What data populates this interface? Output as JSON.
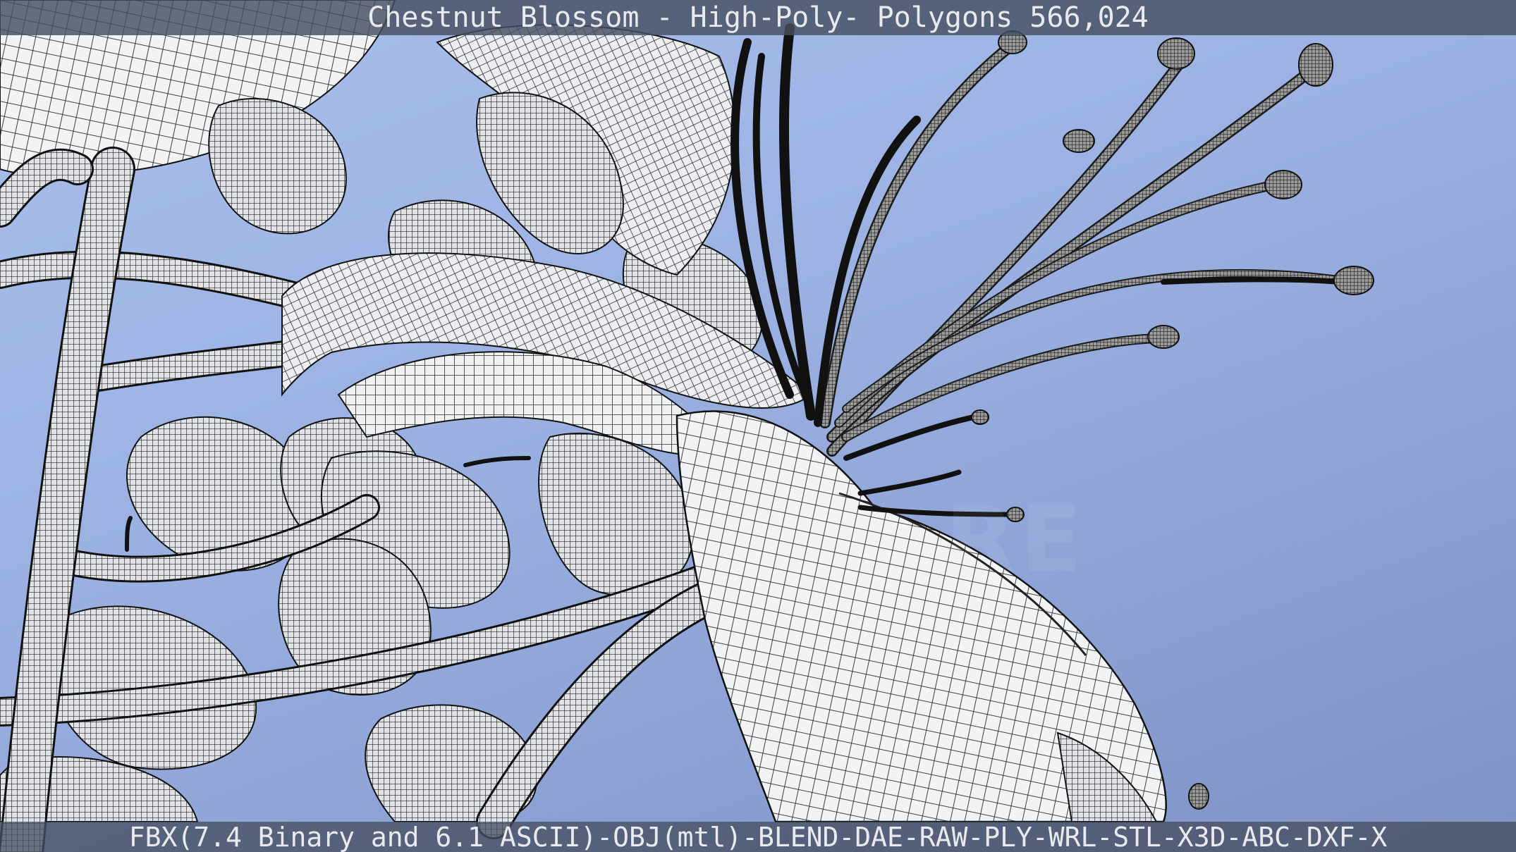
{
  "header": {
    "title": "Chestnut Blossom - High-Poly- Polygons 566,024"
  },
  "footer": {
    "formats": "FBX(7.4 Binary and 6.1 ASCII)-OBJ(mtl)-BLEND-DAE-RAW-PLY-WRL-STL-X3D-ABC-DXF-X"
  },
  "colors": {
    "background_top": "#a9c0ec",
    "background_bottom": "#7e92c4",
    "mesh_fill": "#eef0f2",
    "wire": "#1a1a1a",
    "bar": "#464e62",
    "bar_text": "#e8eaee"
  }
}
